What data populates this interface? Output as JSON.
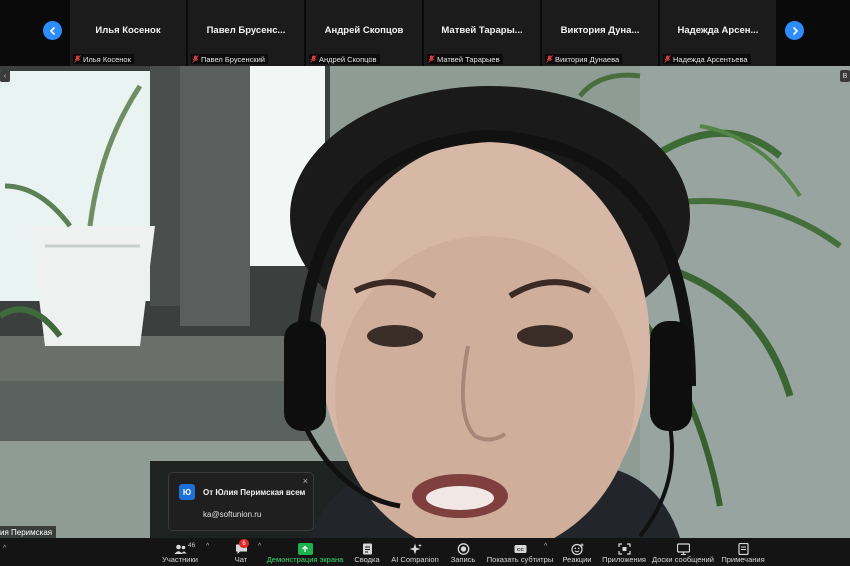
{
  "participants": [
    {
      "name": "Илья Косенок",
      "label": "Илья Косенок"
    },
    {
      "name": "Павел Брусенс...",
      "label": "Павел Брусенский"
    },
    {
      "name": "Андрей Скопцов",
      "label": "Андрей Скопцов"
    },
    {
      "name": "Матвей Тарары...",
      "label": "Матвей Тарарыев"
    },
    {
      "name": "Виктория Дуна...",
      "label": "Виктория Дунаева"
    },
    {
      "name": "Надежда Арсен...",
      "label": "Надежда Арсентьева"
    }
  ],
  "video": {
    "speaker_name": "ия Перимская",
    "edge_left": "‹",
    "edge_right": "B"
  },
  "chat_popup": {
    "avatar": "Ю",
    "from": "От Юлия Перимская всем",
    "message": "ka@softunion.ru",
    "close": "×"
  },
  "toolbar": {
    "participants_count": "46",
    "chat_badge": "6",
    "caret": "^",
    "items": [
      {
        "label": "Участники",
        "icon": "participants-icon"
      },
      {
        "label": "Чат",
        "icon": "chat-icon"
      },
      {
        "label": "Демонстрация экрана",
        "icon": "share-screen-icon"
      },
      {
        "label": "Сводка",
        "icon": "summary-icon"
      },
      {
        "label": "AI Companion",
        "icon": "ai-companion-icon"
      },
      {
        "label": "Запись",
        "icon": "record-icon"
      },
      {
        "label": "Показать субтитры",
        "icon": "captions-icon"
      },
      {
        "label": "Реакции",
        "icon": "reactions-icon"
      },
      {
        "label": "Приложения",
        "icon": "apps-icon"
      },
      {
        "label": "Доски сообщений",
        "icon": "whiteboard-icon"
      },
      {
        "label": "Примечания",
        "icon": "notes-icon"
      }
    ]
  },
  "colors": {
    "accent": "#2d8cff",
    "share_green": "#1fb14b",
    "badge_red": "#e02828",
    "toolbar_bg": "#141414"
  }
}
